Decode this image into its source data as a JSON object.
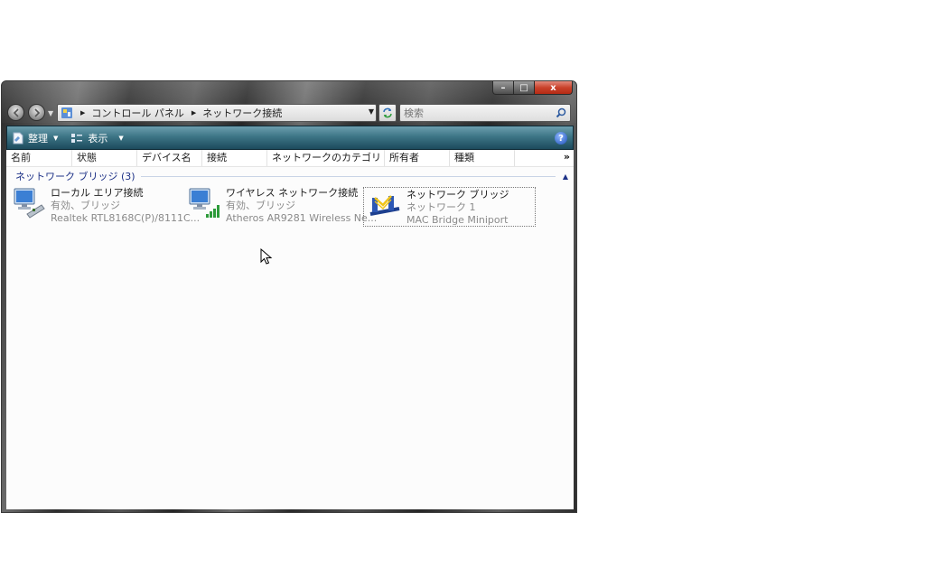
{
  "window": {
    "caption": {
      "minimize": "–",
      "maximize": "□",
      "close": "x"
    }
  },
  "address_bar": {
    "breadcrumbs": [
      "コントロール パネル",
      "ネットワーク接続"
    ]
  },
  "search": {
    "placeholder": "検索"
  },
  "toolbar": {
    "organize_label": "整理",
    "views_label": "表示",
    "help_label": "?"
  },
  "columns": [
    "名前",
    "状態",
    "デバイス名",
    "接続",
    "ネットワークのカテゴリ",
    "所有者",
    "種類"
  ],
  "columns_more": "»",
  "group": {
    "title": "ネットワーク ブリッジ (3)"
  },
  "items": [
    {
      "name": "ローカル エリア接続",
      "status": "有効、ブリッジ",
      "device": "Realtek RTL8168C(P)/8111C...",
      "icon": "network-adapter-icon"
    },
    {
      "name": "ワイヤレス ネットワーク接続",
      "status": "有効、ブリッジ",
      "device": "Atheros AR9281 Wireless Ne...",
      "icon": "wireless-adapter-icon"
    },
    {
      "name": "ネットワーク ブリッジ",
      "status": "ネットワーク 1",
      "device": "MAC Bridge Miniport",
      "icon": "network-bridge-icon",
      "selected": true
    }
  ],
  "colors": {
    "toolbar_top": "#6c9eae",
    "toolbar_bottom": "#1c4a5c",
    "group_title": "#1e3287",
    "subtext": "#8a8a8a"
  }
}
